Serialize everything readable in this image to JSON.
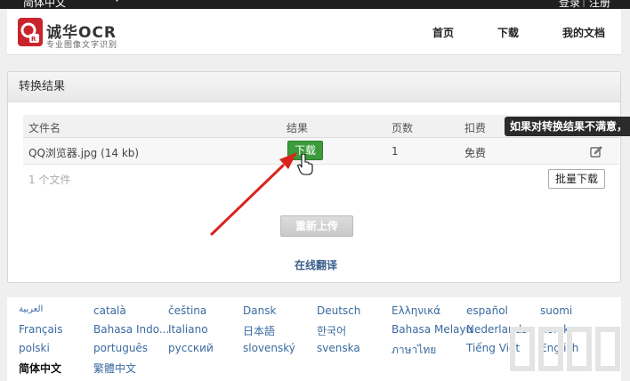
{
  "topbar": {
    "language": "简体中文",
    "login": "登录",
    "separator": "|",
    "register": "注册"
  },
  "header": {
    "brand_name": "诚华OCR",
    "brand_sub": "专业图像文字识别",
    "nav": [
      "首页",
      "下载",
      "我的文档"
    ]
  },
  "panel": {
    "title": "转换结果",
    "columns": [
      "文件名",
      "结果",
      "页数",
      "扣费"
    ],
    "rows": [
      {
        "filename": "QQ浏览器.jpg (14 kb)",
        "result_button": "下载",
        "pages": "1",
        "fee": "免费"
      }
    ],
    "file_count": "1 个文件",
    "batch_download": "批量下载",
    "tooltip": "如果对转换结果不满意，",
    "reupload": "重新上传",
    "online_translate": "在线翻译"
  },
  "languages": [
    [
      "العربية",
      "català",
      "čeština",
      "Dansk",
      "Deutsch",
      "Ελληνικά",
      "español",
      "suomi"
    ],
    [
      "Français",
      "Bahasa Indo...",
      "Italiano",
      "日本語",
      "한국어",
      "Bahasa Melayu",
      "Nederlands",
      "norsk"
    ],
    [
      "polski",
      "português",
      "русский",
      "slovenský",
      "svenska",
      "ภาษาไทย",
      "Tiếng Việt",
      "English"
    ],
    [
      "简体中文",
      "繁體中文"
    ]
  ],
  "colors": {
    "accent_green": "#3c9b3c",
    "arrow_red": "#d9231d",
    "link_blue": "#3a6aa0"
  }
}
